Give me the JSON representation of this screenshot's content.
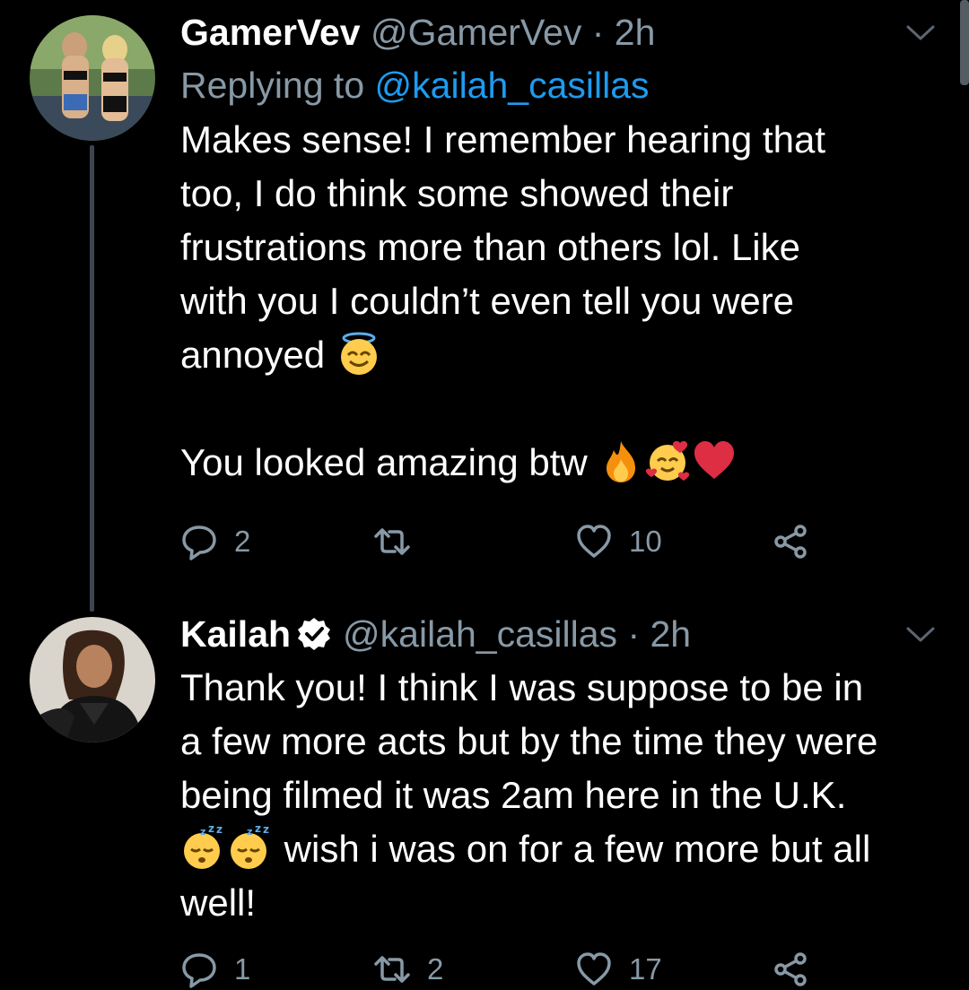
{
  "tweets": [
    {
      "display_name": "GamerVev",
      "handle": "@GamerVev",
      "time": "2h",
      "reply_prefix": "Replying to",
      "reply_to": "@kailah_casillas",
      "body": {
        "line1": "Makes sense! I remember hearing that",
        "line2": "too, I do think some showed their",
        "line3": "frustrations more than others lol. Like",
        "line4": "with you I couldn’t even tell you were",
        "line5": "annoyed",
        "line6": "You looked amazing btw"
      },
      "emojis": [
        "smiling-face-with-halo",
        "fire",
        "smiling-face-with-hearts",
        "red-heart"
      ],
      "actions": {
        "replies": "2",
        "retweets": "",
        "likes": "10"
      }
    },
    {
      "display_name": "Kailah",
      "verified": true,
      "handle": "@kailah_casillas",
      "time": "2h",
      "body": {
        "line1": "Thank you! I think I was suppose to be in",
        "line2": "a few more acts but by the time they were",
        "line3": "being filmed it was 2am here in the U.K.",
        "line4": "wish i was on for a few more but all",
        "line5": "well!"
      },
      "emojis": [
        "sleeping-face",
        "sleeping-face"
      ],
      "actions": {
        "replies": "1",
        "retweets": "2",
        "likes": "17"
      }
    }
  ],
  "colors": {
    "background": "#000000",
    "text": "#ffffff",
    "secondary": "#8899a6",
    "link": "#1d9bf0"
  }
}
